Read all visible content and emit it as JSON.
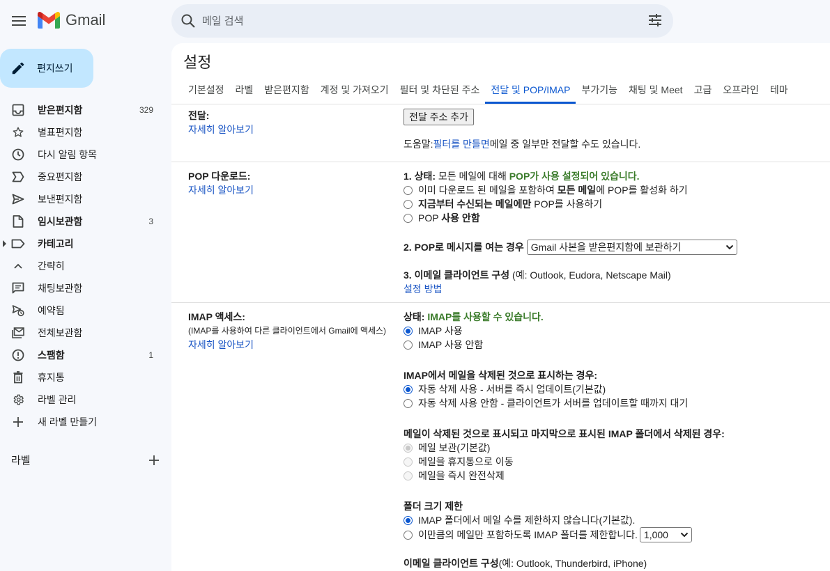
{
  "app": {
    "name": "Gmail"
  },
  "search": {
    "placeholder": "메일 검색"
  },
  "compose": {
    "label": "편지쓰기"
  },
  "nav": [
    {
      "label": "받은편지함",
      "count": "329",
      "bold": true,
      "icon": "inbox-icon"
    },
    {
      "label": "별표편지함",
      "count": "",
      "bold": false,
      "icon": "star-icon"
    },
    {
      "label": "다시 알림 항목",
      "count": "",
      "bold": false,
      "icon": "clock-icon"
    },
    {
      "label": "중요편지함",
      "count": "",
      "bold": false,
      "icon": "important-icon"
    },
    {
      "label": "보낸편지함",
      "count": "",
      "bold": false,
      "icon": "send-icon"
    },
    {
      "label": "임시보관함",
      "count": "3",
      "bold": true,
      "icon": "draft-icon"
    },
    {
      "label": "카테고리",
      "count": "",
      "bold": true,
      "icon": "label-icon"
    },
    {
      "label": "간략히",
      "count": "",
      "bold": false,
      "icon": "chevron-up-icon"
    },
    {
      "label": "채팅보관함",
      "count": "",
      "bold": false,
      "icon": "chat-icon"
    },
    {
      "label": "예약됨",
      "count": "",
      "bold": false,
      "icon": "scheduled-icon"
    },
    {
      "label": "전체보관함",
      "count": "",
      "bold": false,
      "icon": "all-mail-icon"
    },
    {
      "label": "스팸함",
      "count": "1",
      "bold": true,
      "icon": "spam-icon"
    },
    {
      "label": "휴지통",
      "count": "",
      "bold": false,
      "icon": "trash-icon"
    },
    {
      "label": "라벨 관리",
      "count": "",
      "bold": false,
      "icon": "gear-icon"
    },
    {
      "label": "새 라벨 만들기",
      "count": "",
      "bold": false,
      "icon": "plus-icon"
    }
  ],
  "labels_header": "라벨",
  "settings": {
    "title": "설정",
    "tabs": [
      "기본설정",
      "라벨",
      "받은편지함",
      "계정 및 가져오기",
      "필터 및 차단된 주소",
      "전달 및 POP/IMAP",
      "부가기능",
      "채팅 및 Meet",
      "고급",
      "오프라인",
      "테마"
    ],
    "active_tab": "전달 및 POP/IMAP",
    "forwarding": {
      "title": "전달:",
      "learn_more": "자세히 알아보기",
      "add_button": "전달 주소 추가",
      "tip_prefix": "도움말: ",
      "tip_link": "필터를 만들면",
      "tip_suffix": " 메일 중 일부만 전달할 수도 있습니다."
    },
    "pop": {
      "title": "POP 다운로드:",
      "learn_more": "자세히 알아보기",
      "status_label": "1. 상태:",
      "status_text": " 모든 메일에 대해 ",
      "status_green": "POP가 사용 설정되어 있습니다.",
      "options": [
        {
          "pre": "이미 다운로드 된 메일을 포함하여 ",
          "bold": "모든 메일",
          "post": "에 POP를 활성화 하기",
          "checked": false
        },
        {
          "pre": "",
          "bold": "지금부터 수신되는 메일에만",
          "post": " POP를 사용하기",
          "checked": false
        },
        {
          "pre": "POP ",
          "bold": "사용 안함",
          "post": "",
          "checked": false
        }
      ],
      "open_label": "2. POP로 메시지를 여는 경우",
      "open_select": "Gmail 사본을 받은편지함에 보관하기",
      "client_label": "3. 이메일 클라이언트 구성",
      "client_example": " (예: Outlook, Eudora, Netscape Mail)",
      "setup_link": "설정 방법"
    },
    "imap": {
      "title": "IMAP 액세스:",
      "subtitle": "(IMAP를 사용하여 다른 클라이언트에서 Gmail에 액세스)",
      "learn_more": "자세히 알아보기",
      "status_label": "상태: ",
      "status_green": "IMAP를 사용할 수 있습니다.",
      "access_options": [
        {
          "label": "IMAP 사용",
          "checked": true
        },
        {
          "label": "IMAP 사용 안함",
          "checked": false
        }
      ],
      "delete_title": "IMAP에서 메일을 삭제된 것으로 표시하는 경우:",
      "delete_options": [
        {
          "label": "자동 삭제 사용 - 서버를 즉시 업데이트(기본값)",
          "checked": true
        },
        {
          "label": "자동 삭제 사용 안함 - 클라이언트가 서버를 업데이트할 때까지 대기",
          "checked": false
        }
      ],
      "expunge_title": "메일이 삭제된 것으로 표시되고 마지막으로 표시된 IMAP 폴더에서 삭제된 경우:",
      "expunge_options": [
        {
          "label": "메일 보관(기본값)",
          "checked": true
        },
        {
          "label": "메일을 휴지통으로 이동",
          "checked": false
        },
        {
          "label": "메일을 즉시 완전삭제",
          "checked": false
        }
      ],
      "folder_title": "폴더 크기 제한",
      "folder_options": [
        {
          "label": "IMAP 폴더에서 메일 수를 제한하지 않습니다(기본값).",
          "checked": true
        },
        {
          "label": "이만큼의 메일만 포함하도록 IMAP 폴더를 제한합니다.",
          "checked": false
        }
      ],
      "folder_limit_select": "1,000",
      "client_label": "이메일 클라이언트 구성",
      "client_example": "(예: Outlook, Thunderbird, iPhone)"
    }
  },
  "colors": {
    "accent": "#0b57d0",
    "compose_bg": "#c2e7ff",
    "status_green": "#3a7b2a",
    "link": "#1a55c4"
  }
}
